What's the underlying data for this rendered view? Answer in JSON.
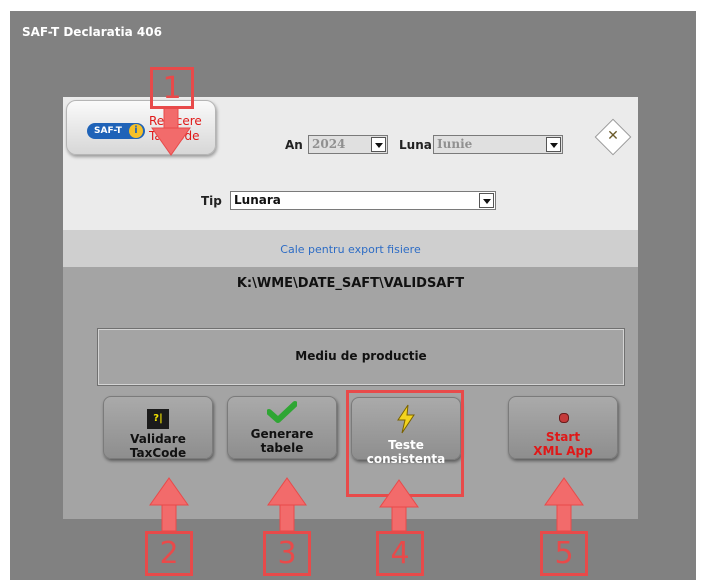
{
  "window": {
    "title": "SAF-T Declaratia 406"
  },
  "header": {
    "saft_logo_text": "SAF-T",
    "saft_logo_badge": "i",
    "refacere_line1": "Refacere",
    "refacere_line2": "TaxCode",
    "an_label": "An",
    "an_value": "2024",
    "luna_label": "Luna",
    "luna_value": "Iunie",
    "close_symbol": "✕"
  },
  "tip": {
    "label": "Tip",
    "value": "Lunara"
  },
  "export_path": {
    "caption": "Cale pentru export fisiere",
    "value": "K:\\WME\\DATE_SAFT\\VALIDSAFT"
  },
  "environment": {
    "label": "Mediu de productie"
  },
  "actions": {
    "validare_line1": "Validare",
    "validare_line2": "TaxCode",
    "validare_icon": "?|",
    "generare_line1": "Generare",
    "generare_line2": "tabele",
    "teste_line1": "Teste",
    "teste_line2": "consistenta",
    "start_line1": "Start",
    "start_line2": "XML App"
  },
  "annotations": {
    "n1": "1",
    "n2": "2",
    "n3": "3",
    "n4": "4",
    "n5": "5"
  },
  "colors": {
    "annotation": "#e84a4a",
    "accent_red": "#e01818",
    "link_blue": "#2d6cc5",
    "panel_gray": "#a4a4a4",
    "window_gray": "#818181"
  }
}
